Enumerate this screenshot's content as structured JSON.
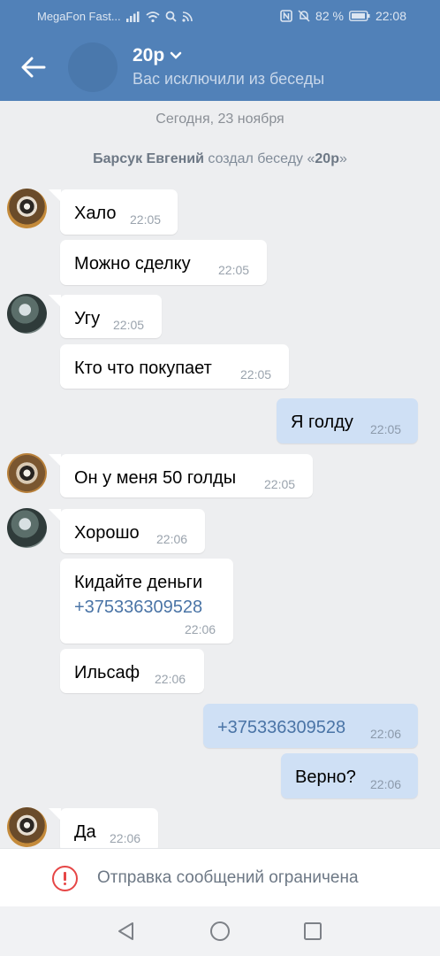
{
  "statusbar": {
    "carrier": "MegaFon Fast...",
    "battery": "82 %",
    "time": "22:08"
  },
  "header": {
    "title": "20р",
    "subtitle": "Вас исключили из беседы",
    "icons": [
      "back-arrow-icon",
      "chevron-down-icon"
    ],
    "color": "#5181b8"
  },
  "chat": {
    "date": "Сегодня, 23 ноября",
    "system": {
      "author": "Барсук Евгений",
      "action": " создал беседу «",
      "chat": "20р",
      "end": "»"
    },
    "messages": [
      {
        "dir": "in",
        "text": "Хало",
        "time": "22:05"
      },
      {
        "dir": "in",
        "text": "Можно сделку",
        "time": "22:05"
      },
      {
        "dir": "in",
        "text": "Угу",
        "time": "22:05"
      },
      {
        "dir": "in",
        "text": "Кто что покупает",
        "time": "22:05"
      },
      {
        "dir": "out",
        "text": "Я голду",
        "time": "22:05"
      },
      {
        "dir": "in",
        "text": "Он у меня 50 голды",
        "time": "22:05"
      },
      {
        "dir": "in",
        "text": "Хорошо",
        "time": "22:06"
      },
      {
        "dir": "in",
        "text": "Кидайте деньги",
        "link": "+375336309528",
        "time": "22:06"
      },
      {
        "dir": "in",
        "text": "Ильсаф",
        "time": "22:06"
      },
      {
        "dir": "out",
        "link": "+375336309528",
        "time": "22:06"
      },
      {
        "dir": "out",
        "text": "Верно?",
        "time": "22:06"
      },
      {
        "dir": "in",
        "text": "Да",
        "time": "22:06"
      }
    ]
  },
  "restricted": {
    "text": "Отправка сообщений ограничена",
    "icon": "alert-circle-icon",
    "color": "#e64646"
  },
  "navbar": {
    "icons": [
      "nav-back-icon",
      "nav-home-icon",
      "nav-recents-icon"
    ]
  }
}
